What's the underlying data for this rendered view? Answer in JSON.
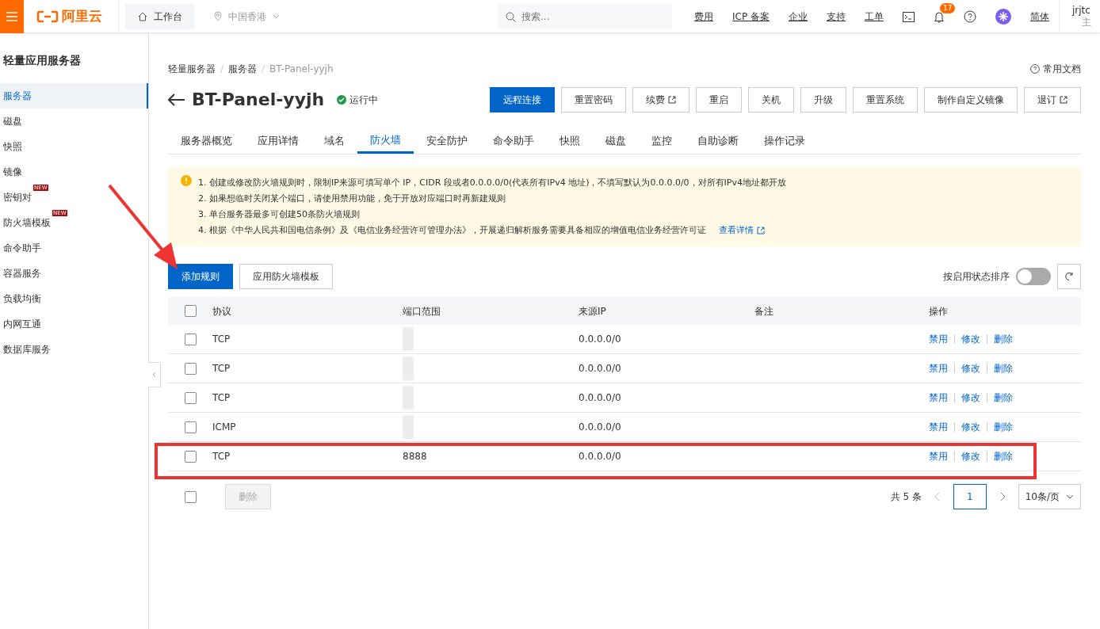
{
  "topbar": {
    "logo": "阿里云",
    "workbench": "工作台",
    "region": "中国香港",
    "search": {
      "placeholder": "搜索..."
    },
    "links": [
      "费用",
      "ICP 备案",
      "企业",
      "支持",
      "工单"
    ],
    "notification_count": "17",
    "language": "简体",
    "user": {
      "name": "jrjtc",
      "role": "主"
    }
  },
  "sidebar": {
    "title": "轻量应用服务器",
    "items": [
      {
        "label": "服务器",
        "selected": true
      },
      {
        "label": "磁盘",
        "selected": false
      },
      {
        "label": "快照",
        "selected": false
      },
      {
        "label": "镜像",
        "selected": false
      },
      {
        "label": "密钥对",
        "selected": false,
        "badge": "NEW"
      },
      {
        "label": "防火墙模板",
        "selected": false,
        "badge": "NEW"
      },
      {
        "label": "命令助手",
        "selected": false
      },
      {
        "label": "容器服务",
        "selected": false
      },
      {
        "label": "负载均衡",
        "selected": false
      },
      {
        "label": "内网互通",
        "selected": false
      },
      {
        "label": "数据库服务",
        "selected": false
      }
    ]
  },
  "breadcrumb": [
    "轻量服务器",
    "服务器",
    "BT-Panel-yyjh"
  ],
  "breadcrumb_separator": "/",
  "docs_link": "常用文档",
  "server": {
    "name": "BT-Panel-yyjh",
    "status": "运行中"
  },
  "actions": [
    {
      "label": "远程连接",
      "primary": true,
      "external": false
    },
    {
      "label": "重置密码",
      "primary": false,
      "external": false
    },
    {
      "label": "续费",
      "primary": false,
      "external": true
    },
    {
      "label": "重启",
      "primary": false,
      "external": false
    },
    {
      "label": "关机",
      "primary": false,
      "external": false
    },
    {
      "label": "升级",
      "primary": false,
      "external": false
    },
    {
      "label": "重置系统",
      "primary": false,
      "external": false
    },
    {
      "label": "制作自定义镜像",
      "primary": false,
      "external": false
    },
    {
      "label": "退订",
      "primary": false,
      "external": true
    }
  ],
  "tabs": [
    {
      "label": "服务器概览",
      "selected": false
    },
    {
      "label": "应用详情",
      "selected": false
    },
    {
      "label": "域名",
      "selected": false
    },
    {
      "label": "防火墙",
      "selected": true
    },
    {
      "label": "安全防护",
      "selected": false
    },
    {
      "label": "命令助手",
      "selected": false
    },
    {
      "label": "快照",
      "selected": false
    },
    {
      "label": "磁盘",
      "selected": false
    },
    {
      "label": "监控",
      "selected": false
    },
    {
      "label": "自助诊断",
      "selected": false
    },
    {
      "label": "操作记录",
      "selected": false
    }
  ],
  "notice": {
    "lines": [
      "1. 创建或修改防火墙规则时，限制IP来源可填写单个 IP，CIDR 段或者0.0.0.0/0(代表所有IPv4 地址)，不填写默认为0.0.0.0/0，对所有IPv4地址都开放",
      "2. 如果想临时关闭某个端口，请使用禁用功能，免于开放对应端口时再新建规则",
      "3. 单台服务器最多可创建50条防火墙规则",
      "4. 根据《中华人民共和国电信条例》及《电信业务经营许可管理办法》，开展递归解析服务需要具备相应的增值电信业务经营许可证"
    ],
    "link": "查看详情"
  },
  "toolbar": {
    "add_button": "添加规则",
    "template_button": "应用防火墙模板",
    "sort_label": "按启用状态排序",
    "sort_on": false
  },
  "table": {
    "select_all_checked": false,
    "columns": [
      "协议",
      "端口范围",
      "来源IP",
      "备注",
      "操作"
    ],
    "rows": [
      {
        "protocol": "TCP",
        "source": "0.0.0.0/0",
        "checked": false,
        "highlighted": false,
        "actions": [
          "禁用",
          "修改",
          "删除"
        ]
      },
      {
        "protocol": "TCP",
        "source": "0.0.0.0/0",
        "checked": false,
        "highlighted": false,
        "actions": [
          "禁用",
          "修改",
          "删除"
        ]
      },
      {
        "protocol": "TCP",
        "source": "0.0.0.0/0",
        "checked": false,
        "highlighted": false,
        "actions": [
          "禁用",
          "修改",
          "删除"
        ]
      },
      {
        "protocol": "ICMP",
        "source": "0.0.0.0/0",
        "checked": false,
        "highlighted": false,
        "actions": [
          "禁用",
          "修改",
          "删除"
        ]
      },
      {
        "protocol": "TCP",
        "port": "8888",
        "source": "0.0.0.0/0",
        "checked": false,
        "highlighted": true,
        "actions": [
          "禁用",
          "修改",
          "删除"
        ]
      }
    ]
  },
  "footer": {
    "select_all_checked": false,
    "delete_button": "删除",
    "total": "共 5 条",
    "page": "1",
    "page_size": "10条/页"
  }
}
